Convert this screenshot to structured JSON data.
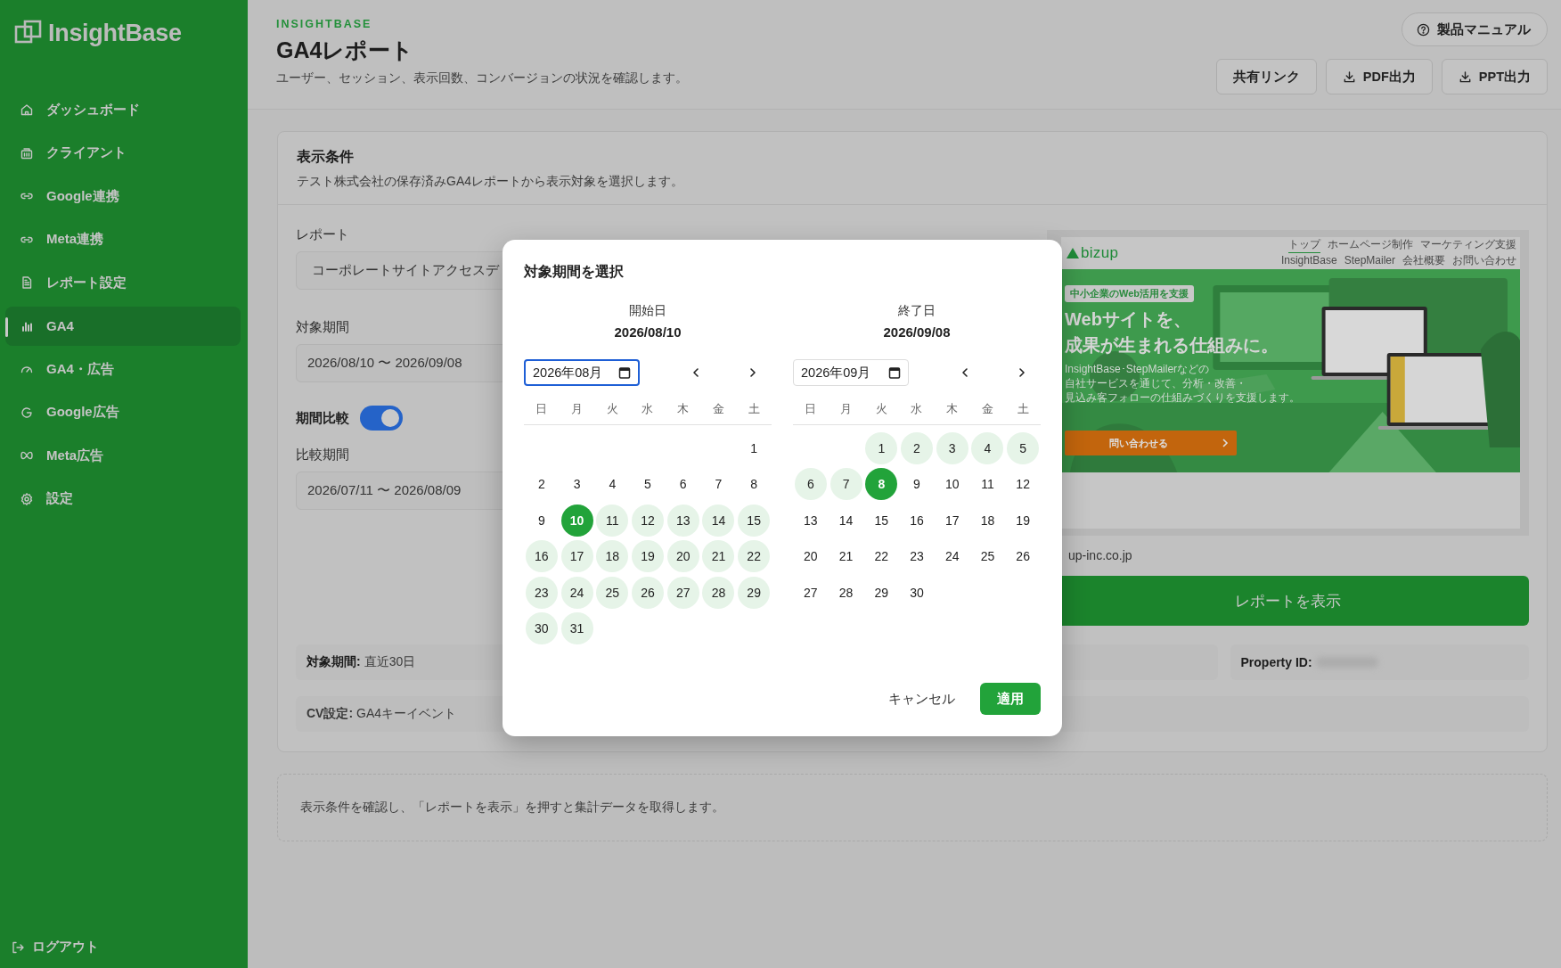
{
  "sidebar": {
    "logo": "InsightBase",
    "items": [
      {
        "label": "ダッシュボード",
        "selected": false
      },
      {
        "label": "クライアント",
        "selected": false
      },
      {
        "label": "Google連携",
        "selected": false
      },
      {
        "label": "Meta連携",
        "selected": false
      },
      {
        "label": "レポート設定",
        "selected": false
      },
      {
        "label": "GA4",
        "selected": true
      },
      {
        "label": "GA4・広告",
        "selected": false
      },
      {
        "label": "Google広告",
        "selected": false
      },
      {
        "label": "Meta広告",
        "selected": false
      },
      {
        "label": "設定",
        "selected": false
      }
    ],
    "logout": "ログアウト"
  },
  "header": {
    "eyebrow": "INSIGHTBASE",
    "title": "GA4レポート",
    "subtitle": "ユーザー、セッション、表示回数、コンバージョンの状況を確認します。",
    "manual_button": "製品マニュアル",
    "buttons": [
      {
        "label": "共有リンク",
        "kind": "plain"
      },
      {
        "label": "PDF出力",
        "kind": "download"
      },
      {
        "label": "PPT出力",
        "kind": "download"
      }
    ]
  },
  "conditions": {
    "title": "表示条件",
    "description": "テスト株式会社の保存済みGA4レポートから表示対象を選択します。",
    "report": {
      "label": "レポート",
      "value": "コーポレートサイトアクセスデ"
    },
    "period": {
      "label": "対象期間",
      "value": "2026/08/10 〜 2026/09/08"
    },
    "compare_toggle": {
      "label": "期間比較",
      "on": true
    },
    "compare_period": {
      "label": "比較期間",
      "value": "2026/07/11 〜 2026/08/09"
    },
    "preview": {
      "logo": "bizup",
      "nav": [
        {
          "label": "トップ",
          "selected": true
        },
        {
          "label": "ホームページ制作",
          "selected": false
        },
        {
          "label": "マーケティング支援",
          "selected": false
        },
        {
          "label": "InsightBase",
          "selected": false
        },
        {
          "label": "StepMailer",
          "selected": false
        },
        {
          "label": "会社概要",
          "selected": false
        },
        {
          "label": "お問い合わせ",
          "selected": false
        }
      ],
      "badge": "中小企業のWeb活用を支援",
      "headline": [
        "Webサイトを、",
        "成果が生まれる仕組みに。"
      ],
      "body": [
        "InsightBase･StepMailerなどの",
        "自社サービスを通じて、分析・改善・",
        "見込み客フォローの仕組みづくりを支援します。"
      ],
      "cta": "問い合わせる"
    },
    "site_url": "up-inc.co.jp",
    "show_button": "レポートを表示",
    "info": [
      {
        "label": "対象期間:",
        "value": "直近30日"
      },
      {
        "label": "Property ID:"
      }
    ],
    "cv": {
      "label": "CV設定:",
      "value": "GA4キーイベント"
    }
  },
  "notice": "表示条件を確認し、「レポートを表示」を押すと集計データを取得します。",
  "dialog": {
    "title": "対象期間を選択",
    "calendars": [
      {
        "weekdays": [
          "日",
          "月",
          "火",
          "水",
          "木",
          "金",
          "土"
        ],
        "heading": "開始日",
        "date": "2026/08/10",
        "month_input": {
          "value": "2026年08月",
          "focused": true
        },
        "weeks": [
          [
            {
              "kind": "blank"
            },
            {
              "kind": "blank"
            },
            {
              "kind": "blank"
            },
            {
              "kind": "blank"
            },
            {
              "kind": "blank"
            },
            {
              "kind": "blank"
            },
            {
              "kind": "day",
              "day": "1",
              "selected": false,
              "in_range": false
            }
          ],
          [
            {
              "kind": "day",
              "day": "2",
              "selected": false,
              "in_range": false
            },
            {
              "kind": "day",
              "day": "3",
              "selected": false,
              "in_range": false
            },
            {
              "kind": "day",
              "day": "4",
              "selected": false,
              "in_range": false
            },
            {
              "kind": "day",
              "day": "5",
              "selected": false,
              "in_range": false
            },
            {
              "kind": "day",
              "day": "6",
              "selected": false,
              "in_range": false
            },
            {
              "kind": "day",
              "day": "7",
              "selected": false,
              "in_range": false
            },
            {
              "kind": "day",
              "day": "8",
              "selected": false,
              "in_range": false
            }
          ],
          [
            {
              "kind": "day",
              "day": "9",
              "selected": false,
              "in_range": false
            },
            {
              "kind": "day",
              "day": "10",
              "selected": true,
              "in_range": false
            },
            {
              "kind": "day",
              "day": "11",
              "selected": false,
              "in_range": true
            },
            {
              "kind": "day",
              "day": "12",
              "selected": false,
              "in_range": true
            },
            {
              "kind": "day",
              "day": "13",
              "selected": false,
              "in_range": true
            },
            {
              "kind": "day",
              "day": "14",
              "selected": false,
              "in_range": true
            },
            {
              "kind": "day",
              "day": "15",
              "selected": false,
              "in_range": true
            }
          ],
          [
            {
              "kind": "day",
              "day": "16",
              "selected": false,
              "in_range": true
            },
            {
              "kind": "day",
              "day": "17",
              "selected": false,
              "in_range": true
            },
            {
              "kind": "day",
              "day": "18",
              "selected": false,
              "in_range": true
            },
            {
              "kind": "day",
              "day": "19",
              "selected": false,
              "in_range": true
            },
            {
              "kind": "day",
              "day": "20",
              "selected": false,
              "in_range": true
            },
            {
              "kind": "day",
              "day": "21",
              "selected": false,
              "in_range": true
            },
            {
              "kind": "day",
              "day": "22",
              "selected": false,
              "in_range": true
            }
          ],
          [
            {
              "kind": "day",
              "day": "23",
              "selected": false,
              "in_range": true
            },
            {
              "kind": "day",
              "day": "24",
              "selected": false,
              "in_range": true
            },
            {
              "kind": "day",
              "day": "25",
              "selected": false,
              "in_range": true
            },
            {
              "kind": "day",
              "day": "26",
              "selected": false,
              "in_range": true
            },
            {
              "kind": "day",
              "day": "27",
              "selected": false,
              "in_range": true
            },
            {
              "kind": "day",
              "day": "28",
              "selected": false,
              "in_range": true
            },
            {
              "kind": "day",
              "day": "29",
              "selected": false,
              "in_range": true
            }
          ],
          [
            {
              "kind": "day",
              "day": "30",
              "selected": false,
              "in_range": true
            },
            {
              "kind": "day",
              "day": "31",
              "selected": false,
              "in_range": true
            }
          ]
        ]
      },
      {
        "weekdays": [
          "日",
          "月",
          "火",
          "水",
          "木",
          "金",
          "土"
        ],
        "heading": "終了日",
        "date": "2026/09/08",
        "month_input": {
          "value": "2026年09月",
          "focused": false
        },
        "weeks": [
          [
            {
              "kind": "blank"
            },
            {
              "kind": "blank"
            },
            {
              "kind": "day",
              "day": "1",
              "selected": false,
              "in_range": true
            },
            {
              "kind": "day",
              "day": "2",
              "selected": false,
              "in_range": true
            },
            {
              "kind": "day",
              "day": "3",
              "selected": false,
              "in_range": true
            },
            {
              "kind": "day",
              "day": "4",
              "selected": false,
              "in_range": true
            },
            {
              "kind": "day",
              "day": "5",
              "selected": false,
              "in_range": true
            }
          ],
          [
            {
              "kind": "day",
              "day": "6",
              "selected": false,
              "in_range": true
            },
            {
              "kind": "day",
              "day": "7",
              "selected": false,
              "in_range": true
            },
            {
              "kind": "day",
              "day": "8",
              "selected": true,
              "in_range": false
            },
            {
              "kind": "day",
              "day": "9",
              "selected": false,
              "in_range": false
            },
            {
              "kind": "day",
              "day": "10",
              "selected": false,
              "in_range": false
            },
            {
              "kind": "day",
              "day": "11",
              "selected": false,
              "in_range": false
            },
            {
              "kind": "day",
              "day": "12",
              "selected": false,
              "in_range": false
            }
          ],
          [
            {
              "kind": "day",
              "day": "13",
              "selected": false,
              "in_range": false
            },
            {
              "kind": "day",
              "day": "14",
              "selected": false,
              "in_range": false
            },
            {
              "kind": "day",
              "day": "15",
              "selected": false,
              "in_range": false
            },
            {
              "kind": "day",
              "day": "16",
              "selected": false,
              "in_range": false
            },
            {
              "kind": "day",
              "day": "17",
              "selected": false,
              "in_range": false
            },
            {
              "kind": "day",
              "day": "18",
              "selected": false,
              "in_range": false
            },
            {
              "kind": "day",
              "day": "19",
              "selected": false,
              "in_range": false
            }
          ],
          [
            {
              "kind": "day",
              "day": "20",
              "selected": false,
              "in_range": false
            },
            {
              "kind": "day",
              "day": "21",
              "selected": false,
              "in_range": false
            },
            {
              "kind": "day",
              "day": "22",
              "selected": false,
              "in_range": false
            },
            {
              "kind": "day",
              "day": "23",
              "selected": false,
              "in_range": false
            },
            {
              "kind": "day",
              "day": "24",
              "selected": false,
              "in_range": false
            },
            {
              "kind": "day",
              "day": "25",
              "selected": false,
              "in_range": false
            },
            {
              "kind": "day",
              "day": "26",
              "selected": false,
              "in_range": false
            }
          ],
          [
            {
              "kind": "day",
              "day": "27",
              "selected": false,
              "in_range": false
            },
            {
              "kind": "day",
              "day": "28",
              "selected": false,
              "in_range": false
            },
            {
              "kind": "day",
              "day": "29",
              "selected": false,
              "in_range": false
            },
            {
              "kind": "day",
              "day": "30",
              "selected": false,
              "in_range": false
            }
          ]
        ]
      }
    ],
    "cancel": "キャンセル",
    "apply": "適用"
  }
}
